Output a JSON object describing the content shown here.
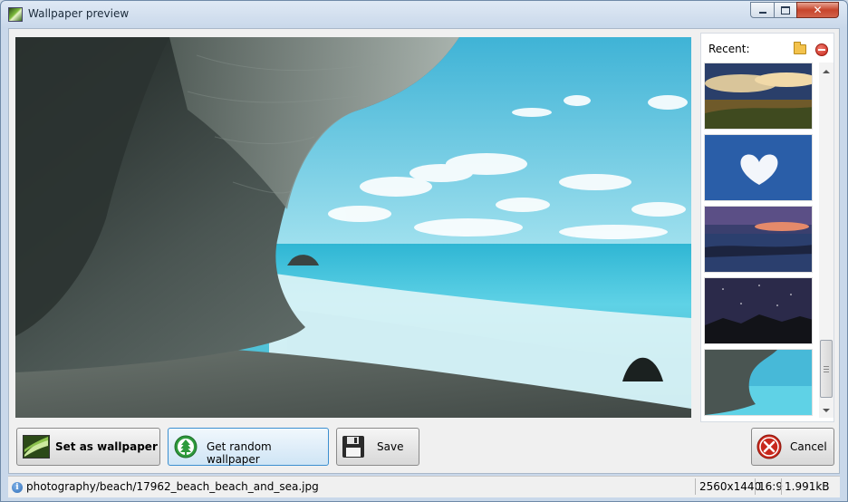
{
  "window": {
    "title": "Wallpaper preview"
  },
  "sidebar": {
    "recent_label": "Recent:"
  },
  "buttons": {
    "set_wallpaper": "Set as wallpaper",
    "random": "Get random wallpaper",
    "save": "Save",
    "cancel": "Cancel"
  },
  "status": {
    "path": "photography/beach/17962_beach_beach_and_sea.jpg",
    "resolution": "2560x1440",
    "ratio": "16:9",
    "size": "1.991kB"
  },
  "colors": {
    "accent_focus": "#3c8fd0",
    "close_red": "#c7452c",
    "random_icon_green": "#2e9a3c"
  }
}
